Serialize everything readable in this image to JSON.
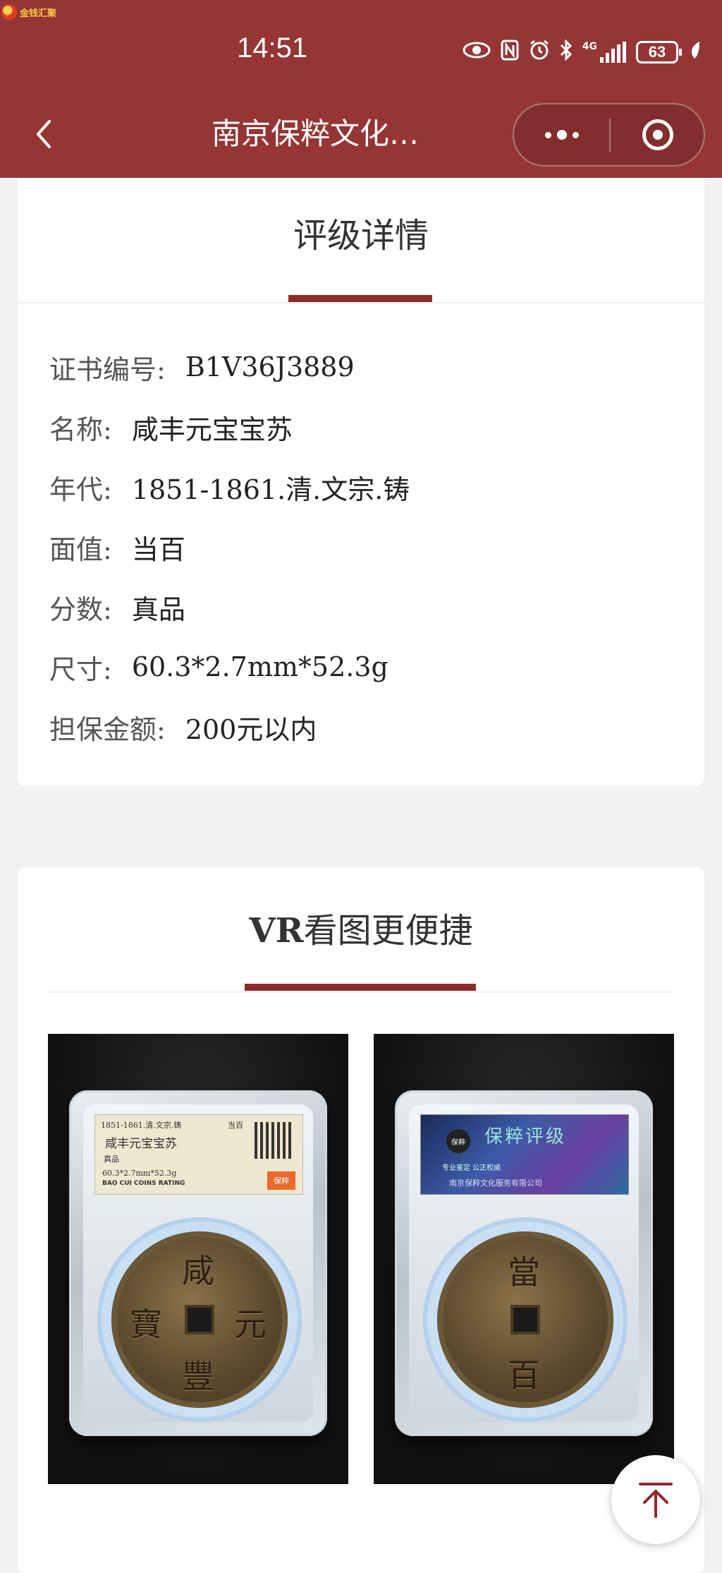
{
  "status_bar": {
    "time": "14:51",
    "network": "4G",
    "battery": "63",
    "icons": [
      "eye-icon",
      "nfc-icon",
      "alarm-icon",
      "bluetooth-icon",
      "signal-icon",
      "battery-icon",
      "leaf-icon"
    ]
  },
  "app_logo": {
    "text": "金钱汇聚"
  },
  "nav": {
    "title": "南京保粹文化…",
    "back_icon": "chevron-left-icon",
    "more_icon": "more-dots-icon",
    "close_icon": "target-icon",
    "color": "#953535"
  },
  "grading": {
    "title": "评级详情",
    "rows": [
      {
        "label": "证书编号:",
        "value": "B1V36J3889"
      },
      {
        "label": "名称:",
        "value": "咸丰元宝宝苏"
      },
      {
        "label": "年代:",
        "value": "1851-1861.清.文宗.铸"
      },
      {
        "label": "面值:",
        "value": "当百"
      },
      {
        "label": "分数:",
        "value": "真品"
      },
      {
        "label": "尺寸:",
        "value": "60.3*2.7mm*52.3g"
      },
      {
        "label": "担保金额:",
        "value": "200元以内"
      }
    ]
  },
  "vr": {
    "title_bold": "VR",
    "title_rest": "看图更便捷",
    "front_label": {
      "era": "1851-1861.清.文宗.铸",
      "denom": "当百",
      "name": "咸丰元宝宝苏",
      "grade": "真品",
      "size": "60.3*2.7mm*52.3g",
      "brand": "BAO CUI COINS RATING",
      "stamp": "保粹"
    },
    "front_coin_chars": [
      "咸",
      "豐",
      "寶",
      "元"
    ],
    "back_label": {
      "logo": "保粹",
      "title": "保粹评级",
      "line1": "专业鉴定 公正权威",
      "line2": "南京保粹文化服务有限公司"
    },
    "back_coin_chars": [
      "當",
      "百"
    ]
  },
  "to_top": {
    "icon": "arrow-up-to-top-icon"
  }
}
